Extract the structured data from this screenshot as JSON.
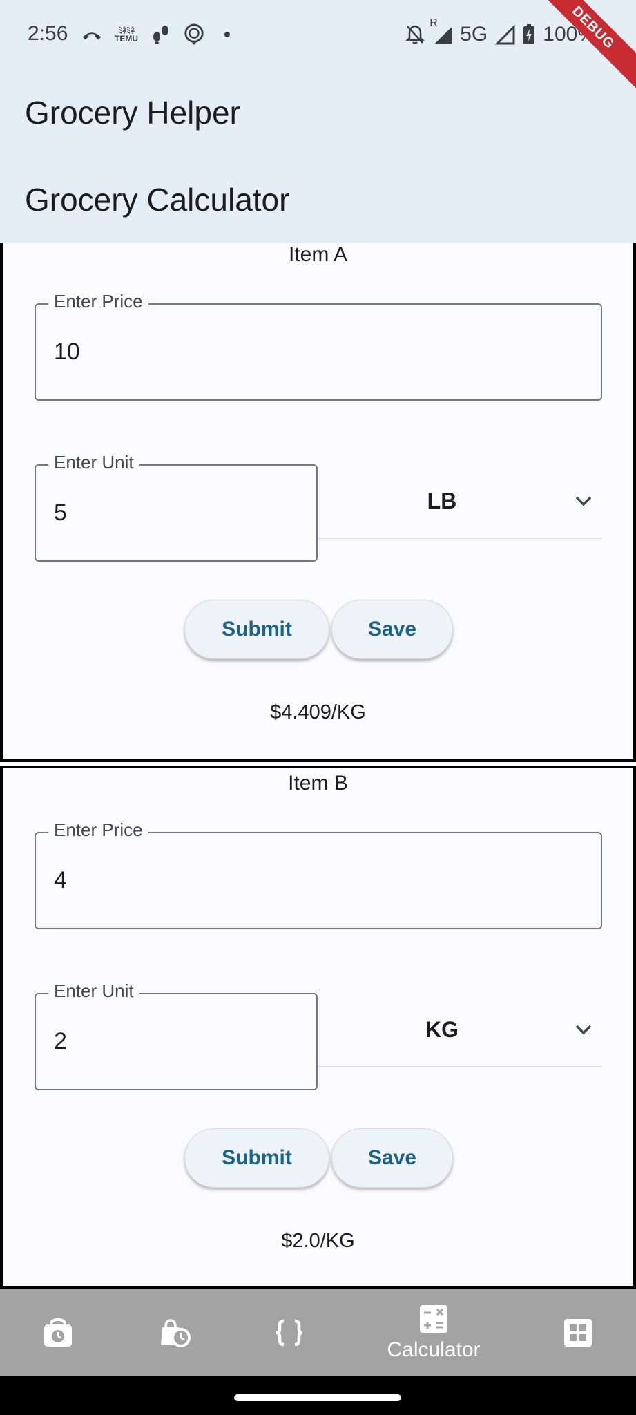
{
  "status_bar": {
    "time": "2:56",
    "left_icons": [
      "missed-call-icon",
      "temu-icon",
      "footsteps-icon",
      "assistant-icon",
      "dot-icon"
    ],
    "temu_text_top": "ﾐﾈﾐﾈ",
    "temu_text_bottom": "TEMU",
    "network": "5G",
    "roaming": "R",
    "battery": "100%"
  },
  "debug_ribbon": "DEBUG",
  "app_title": "Grocery Helper",
  "page_title": "Grocery Calculator",
  "items": [
    {
      "title": "Item A",
      "price_label": "Enter Price",
      "price_value": "10",
      "unit_label": "Enter Unit",
      "unit_value": "5",
      "unit_type": "LB",
      "submit_label": "Submit",
      "save_label": "Save",
      "result": "$4.409/KG"
    },
    {
      "title": "Item B",
      "price_label": "Enter Price",
      "price_value": "4",
      "unit_label": "Enter Unit",
      "unit_value": "2",
      "unit_type": "KG",
      "submit_label": "Submit",
      "save_label": "Save",
      "result": "$2.0/KG"
    }
  ],
  "bottom_nav": {
    "items": [
      {
        "icon": "weight-scale-icon",
        "label": ""
      },
      {
        "icon": "shopping-bag-clock-icon",
        "label": ""
      },
      {
        "icon": "data-object-icon",
        "label": ""
      },
      {
        "icon": "calculator-icon",
        "label": "Calculator",
        "selected": true
      },
      {
        "icon": "grid-view-icon",
        "label": ""
      }
    ]
  },
  "colors": {
    "appbar_bg": "#e6eef5",
    "button_text": "#1b6389",
    "nav_bg": "#a3a3a3",
    "debug_ribbon": "#c62c32"
  }
}
